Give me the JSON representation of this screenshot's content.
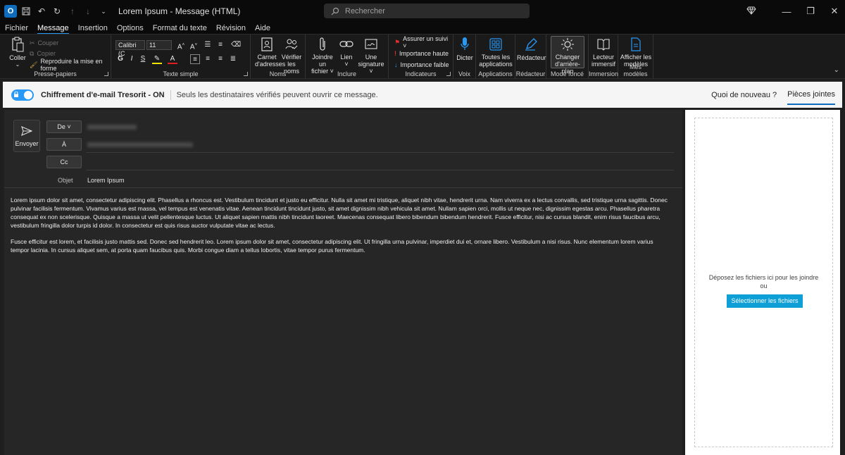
{
  "window": {
    "title": "Lorem Ipsum  -  Message (HTML)",
    "search_placeholder": "Rechercher"
  },
  "menu": {
    "tabs": [
      "Fichier",
      "Message",
      "Insertion",
      "Options",
      "Format du texte",
      "Révision",
      "Aide"
    ],
    "active": "Message"
  },
  "ribbon": {
    "clipboard": {
      "paste": "Coller",
      "cut": "Couper",
      "copy": "Copier",
      "format_painter": "Reproduire la mise en forme",
      "label": "Presse-papiers"
    },
    "text": {
      "font": "Calibri (C",
      "size": "11",
      "bold": "G",
      "italic": "I",
      "underline": "S",
      "label": "Texte simple"
    },
    "names": {
      "address_book": [
        "Carnet",
        "d'adresses"
      ],
      "check_names": [
        "Vérifier",
        "les noms"
      ],
      "label": "Noms"
    },
    "include": {
      "attach": [
        "Joindre un",
        "fichier ˅"
      ],
      "link": [
        "Lien",
        "˅"
      ],
      "signature": [
        "Une",
        "signature ˅"
      ],
      "label": "Inclure"
    },
    "tags": {
      "follow_up": "Assurer un suivi ˅",
      "high": "Importance haute",
      "low": "Importance faible",
      "label": "Indicateurs"
    },
    "voice": {
      "dictate": "Dicter",
      "label": "Voix"
    },
    "apps": {
      "all_apps": [
        "Toutes les",
        "applications"
      ],
      "label": "Applications"
    },
    "editor": {
      "editor": "Rédacteur",
      "label": "Rédacteur"
    },
    "dark": {
      "change_bg": [
        "Changer",
        "d'arrière-plan"
      ],
      "label": "Mode foncé"
    },
    "immersive": {
      "reader": [
        "Lecteur",
        "immersif"
      ],
      "label": "Immersion"
    },
    "templates": {
      "view": [
        "Afficher les",
        "modèles"
      ],
      "label": "Mes modèles"
    }
  },
  "infobar": {
    "title": "Chiffrement d'e-mail Tresorit - ON",
    "message": "Seuls les destinataires vérifiés peuvent ouvrir ce message.",
    "whats_new": "Quoi de nouveau ?",
    "attachments": "Pièces jointes"
  },
  "compose": {
    "send": "Envoyer",
    "from": "De ˅",
    "to": "À",
    "cc": "Cc",
    "subject_label": "Objet",
    "subject": "Lorem Ipsum",
    "body": [
      "Lorem ipsum dolor sit amet, consectetur adipiscing elit. Phasellus a rhoncus est. Vestibulum tincidunt et justo eu efficitur. Nulla sit amet mi tristique, aliquet nibh vitae, hendrerit urna. Nam viverra ex a lectus convallis, sed tristique urna sagittis. Donec pulvinar facilisis fermentum. Vivamus varius est massa, vel tempus est venenatis vitae. Aenean tincidunt tincidunt justo, sit amet dignissim nibh vehicula sit amet. Nullam sapien orci, mollis ut neque nec, dignissim egestas arcu. Phasellus pharetra consequat ex non scelerisque. Quisque a massa ut velit pellentesque luctus. Ut aliquet sapien mattis nibh tincidunt laoreet. Maecenas consequat libero bibendum bibendum hendrerit. Fusce efficitur, nisi ac cursus blandit, enim risus faucibus arcu, vestibulum fringilla dolor turpis id dolor. In consectetur est quis risus auctor vulputate vitae ac lectus.",
      "Fusce efficitur est lorem, et facilisis justo mattis sed. Donec sed hendrerit leo. Lorem ipsum dolor sit amet, consectetur adipiscing elit. Ut fringilla urna pulvinar, imperdiet dui et, ornare libero. Vestibulum a nisi risus. Nunc elementum lorem varius tempor lacinia. In cursus aliquet sem, at porta quam faucibus quis. Morbi congue diam a tellus lobortis, vitae tempor purus fermentum."
    ]
  },
  "attachments_panel": {
    "drop_text": "Déposez les fichiers ici pour les joindre",
    "or": "ou",
    "select_button": "Sélectionner les fichiers"
  }
}
